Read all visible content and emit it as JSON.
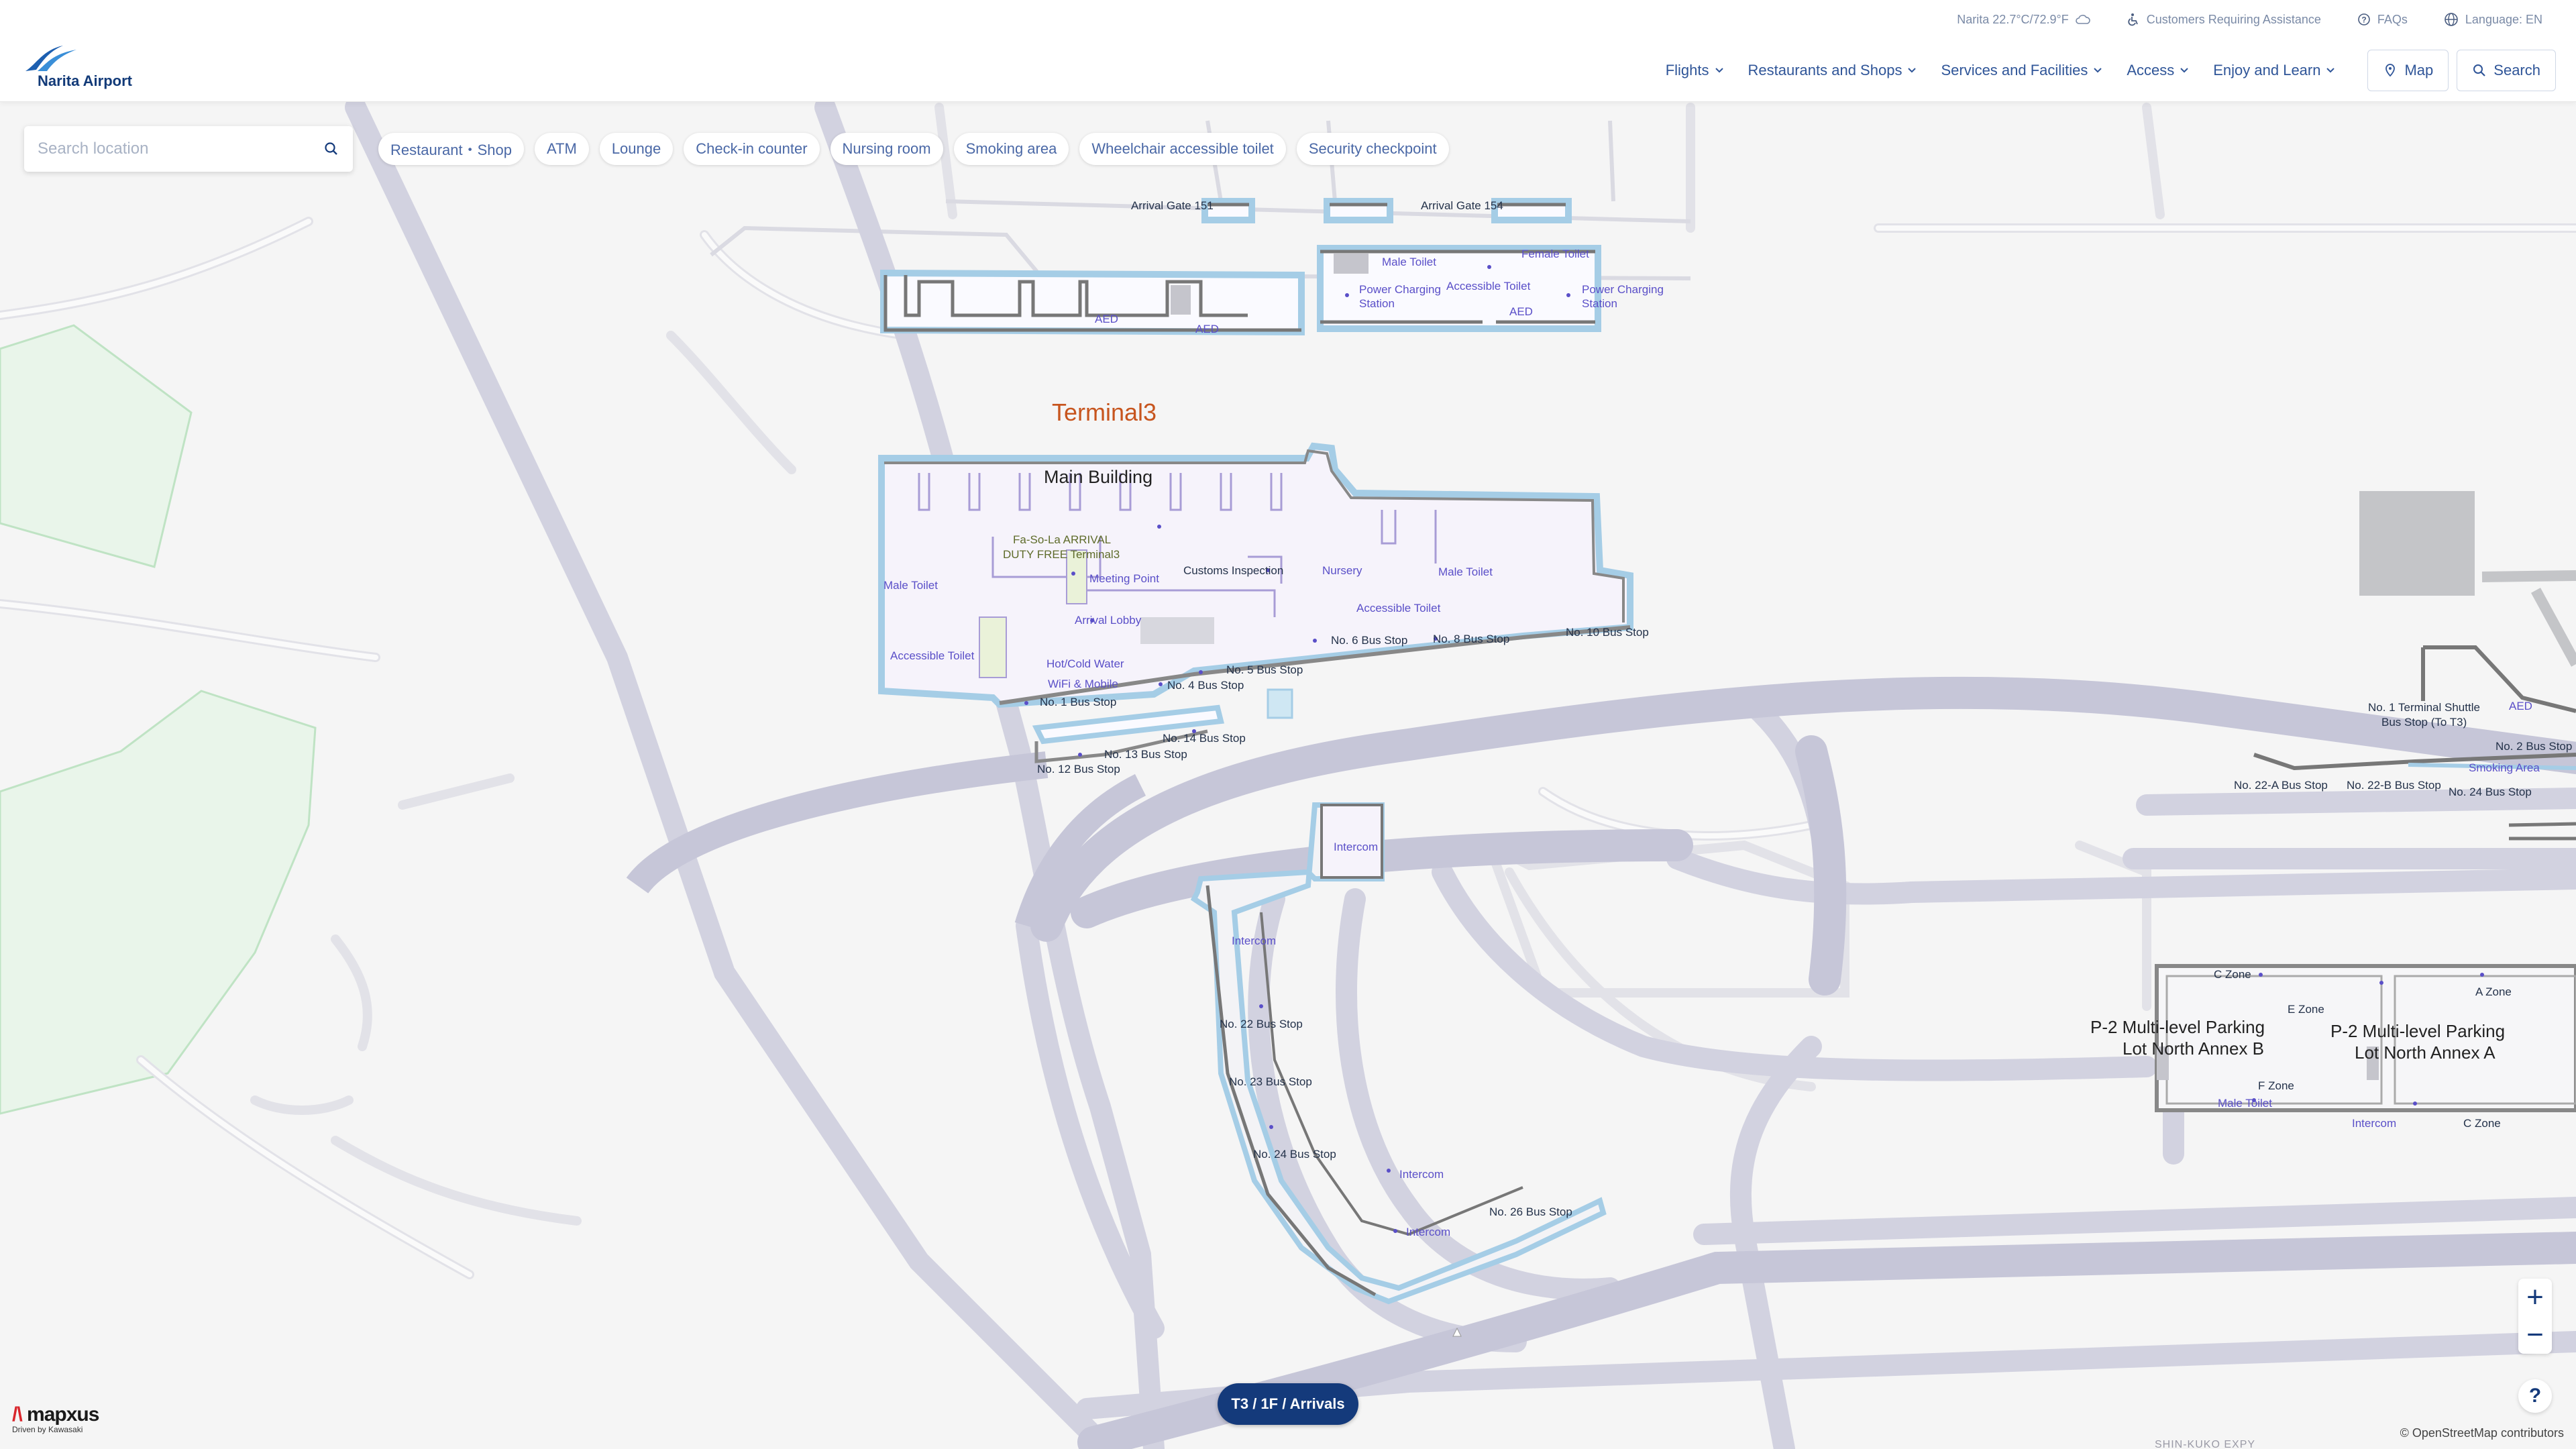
{
  "header": {
    "logo_text": "Narita Airport",
    "weather": "Narita 22.7°C/72.9°F",
    "assistance": "Customers Requiring Assistance",
    "faqs": "FAQs",
    "language": "Language: EN",
    "nav": [
      "Flights",
      "Restaurants and Shops",
      "Services and Facilities",
      "Access",
      "Enjoy and Learn"
    ],
    "map_btn": "Map",
    "search_btn": "Search"
  },
  "search": {
    "placeholder": "Search location"
  },
  "filters": [
    "Restaurant・Shop",
    "ATM",
    "Lounge",
    "Check-in counter",
    "Nursing room",
    "Smoking area",
    "Wheelchair accessible toilet",
    "Security checkpoint"
  ],
  "map": {
    "terminal_label": "Terminal3",
    "building_label": "Main Building",
    "labels": {
      "gate151": "Arrival Gate 151",
      "gate154": "Arrival Gate 154",
      "male_toilet_top": "Male Toilet",
      "female_toilet_top": "Female Toilet",
      "power_left": "Power Charging",
      "power_left2": "Station",
      "acc_toilet_top": "Accessible Toilet",
      "power_right": "Power Charging",
      "power_right2": "Station",
      "aed_a": "AED",
      "aed_b": "AED",
      "aed_c": "AED",
      "duty_free1": "Fa-So-La ARRIVAL",
      "duty_free2": "DUTY FREE Terminal3",
      "meeting": "Meeting Point",
      "customs": "Customs Inspection",
      "nursery": "Nursery",
      "male_toilet_r": "Male Toilet",
      "male_toilet_l": "Male Toilet",
      "acc_toilet_r": "Accessible Toilet",
      "arrival_lobby": "Arrival Lobby",
      "acc_toilet_l": "Accessible Toilet",
      "hot_cold": "Hot/Cold Water",
      "wifi": "WiFi & Mobile",
      "bus1": "No. 1 Bus Stop",
      "bus4": "No. 4 Bus Stop",
      "bus5": "No. 5 Bus Stop",
      "bus6": "No. 6 Bus Stop",
      "bus8": "No. 8 Bus Stop",
      "bus10": "No. 10 Bus Stop",
      "bus12": "No. 12 Bus Stop",
      "bus13": "No. 13 Bus Stop",
      "bus14": "No. 14 Bus Stop",
      "intercom1": "Intercom",
      "intercom2": "Intercom",
      "intercom3": "Intercom",
      "intercom4": "Intercom",
      "bus22": "No. 22 Bus Stop",
      "bus23": "No. 23 Bus Stop",
      "bus24": "No. 24 Bus Stop",
      "bus26": "No. 26 Bus Stop",
      "shuttle1": "No. 1 Terminal Shuttle",
      "shuttle2": "Bus Stop (To T3)",
      "aed_d": "AED",
      "bus2": "No. 2 Bus Stop",
      "smoking": "Smoking Area",
      "bus22a": "No. 22-A Bus Stop",
      "bus22b": "No. 22-B Bus Stop",
      "bus24r": "No. 24 Bus Stop",
      "czone1": "C Zone",
      "ezone": "E Zone",
      "azone": "A Zone",
      "p2b1": "P-2 Multi-level Parking",
      "p2b2": "Lot North Annex B",
      "p2a1": "P-2 Multi-level Parking",
      "p2a2": "Lot North Annex A",
      "fzone": "F Zone",
      "male_toilet_p": "Male Toilet",
      "intercom5": "Intercom",
      "czone2": "C Zone",
      "expy": "SHIN-KUKO EXPY"
    }
  },
  "floor_pill": "T3 / 1F / Arrivals",
  "zoom": {
    "plus": "+",
    "minus": "−"
  },
  "help": "?",
  "mapxus": {
    "brand_a": "/\\ ",
    "brand_b": "mapxus",
    "sub": "Driven by Kawasaki"
  },
  "attribution": "© OpenStreetMap contributors",
  "colors": {
    "brand": "#143a7b",
    "poi": "#5a4fc8",
    "terminal": "#c7551e"
  }
}
